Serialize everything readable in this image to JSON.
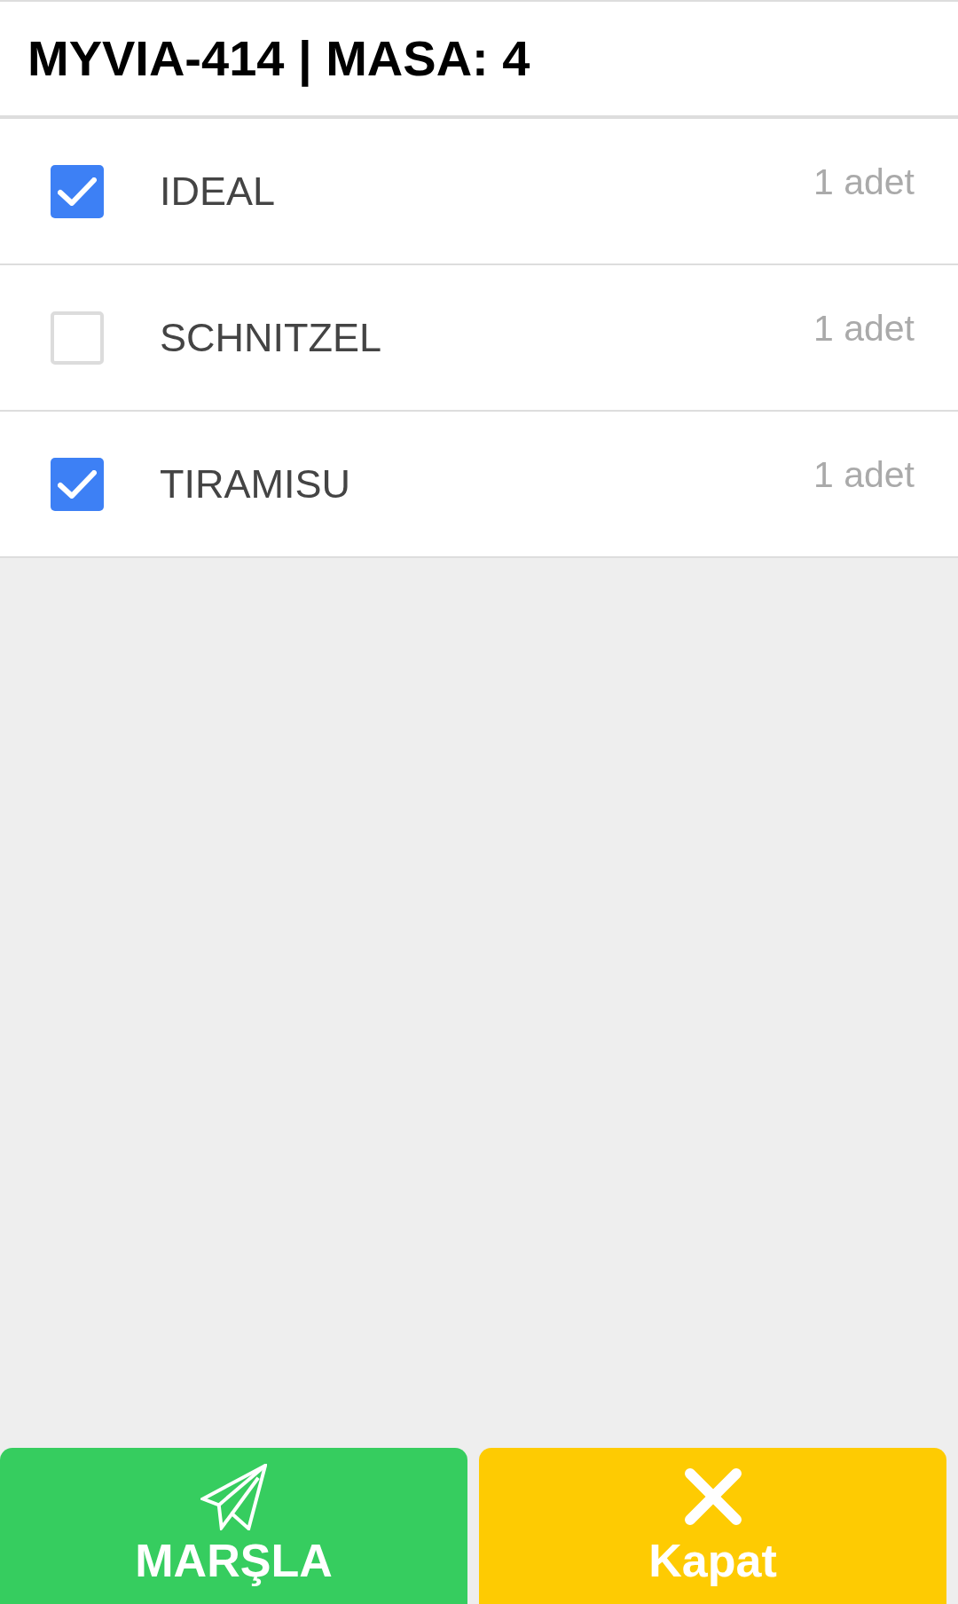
{
  "header": {
    "title": "MYVIA-414 | MASA: 4"
  },
  "items": [
    {
      "name": "IDEAL",
      "quantity": "1 adet",
      "checked": true
    },
    {
      "name": "SCHNITZEL",
      "quantity": "1 adet",
      "checked": false
    },
    {
      "name": "TIRAMISU",
      "quantity": "1 adet",
      "checked": true
    }
  ],
  "buttons": [
    {
      "kind": "send",
      "label": "MARŞLA"
    },
    {
      "kind": "close",
      "label": "Kapat"
    }
  ]
}
